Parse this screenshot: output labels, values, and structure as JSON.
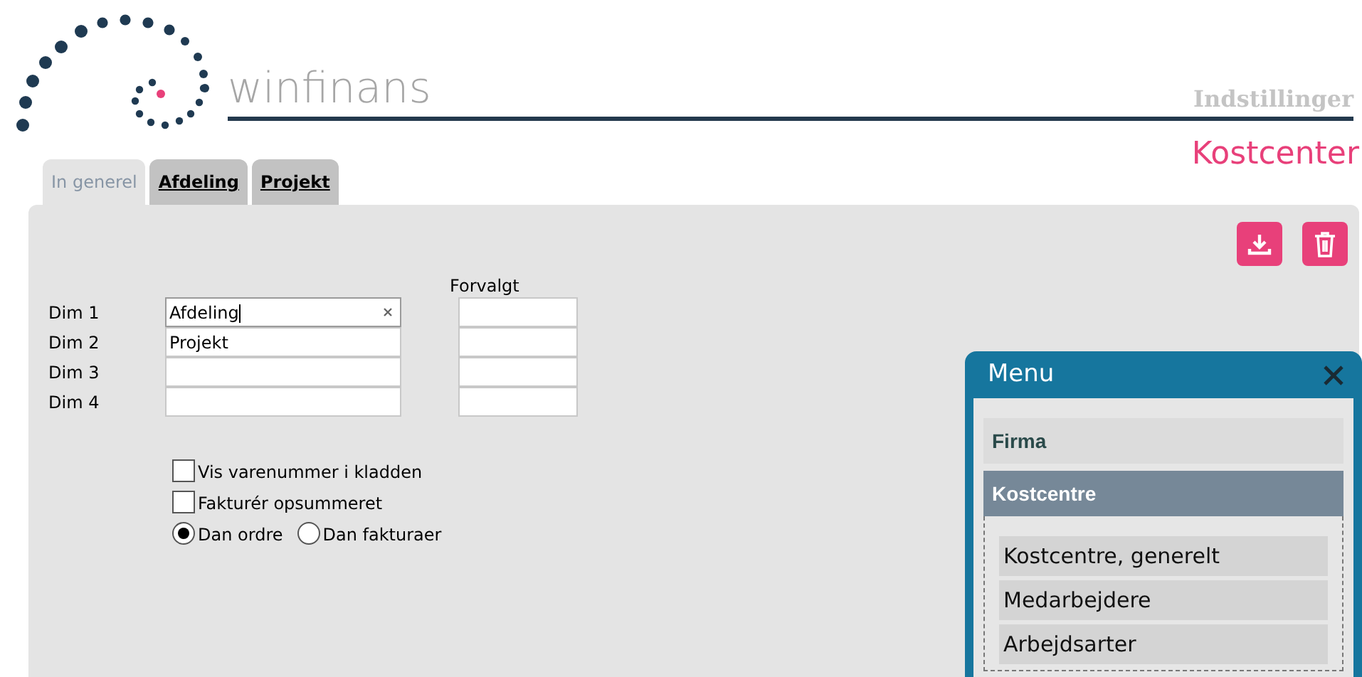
{
  "header": {
    "brand": "winfinans",
    "section": "Indstillinger",
    "page_title": "Kostcenter"
  },
  "tabs": [
    {
      "label": "In generel",
      "selected": true
    },
    {
      "label": "Afdeling",
      "selected": false
    },
    {
      "label": "Projekt",
      "selected": false
    }
  ],
  "form": {
    "default_heading": "Forvalgt",
    "dims": [
      {
        "label": "Dim 1",
        "value": "Afdeling",
        "focused": true
      },
      {
        "label": "Dim 2",
        "value": "Projekt",
        "focused": false
      },
      {
        "label": "Dim 3",
        "focused": false
      },
      {
        "label": "Dim 4",
        "focused": false
      }
    ],
    "checkboxes": [
      {
        "label": "Vis varenummer i kladden",
        "checked": false
      },
      {
        "label": "Fakturér opsummeret",
        "checked": false
      }
    ],
    "radios": [
      {
        "label": "Dan ordre",
        "selected": true
      },
      {
        "label": "Dan fakturaer",
        "selected": false
      }
    ]
  },
  "menu": {
    "title": "Menu",
    "sections": [
      {
        "label": "Firma",
        "selected": false,
        "expanded": false
      },
      {
        "label": "Kostcentre",
        "selected": true,
        "expanded": true,
        "children": [
          {
            "label": "Kostcentre, generelt"
          },
          {
            "label": "Medarbejdere"
          },
          {
            "label": "Arbejdsarter"
          }
        ]
      }
    ]
  }
}
